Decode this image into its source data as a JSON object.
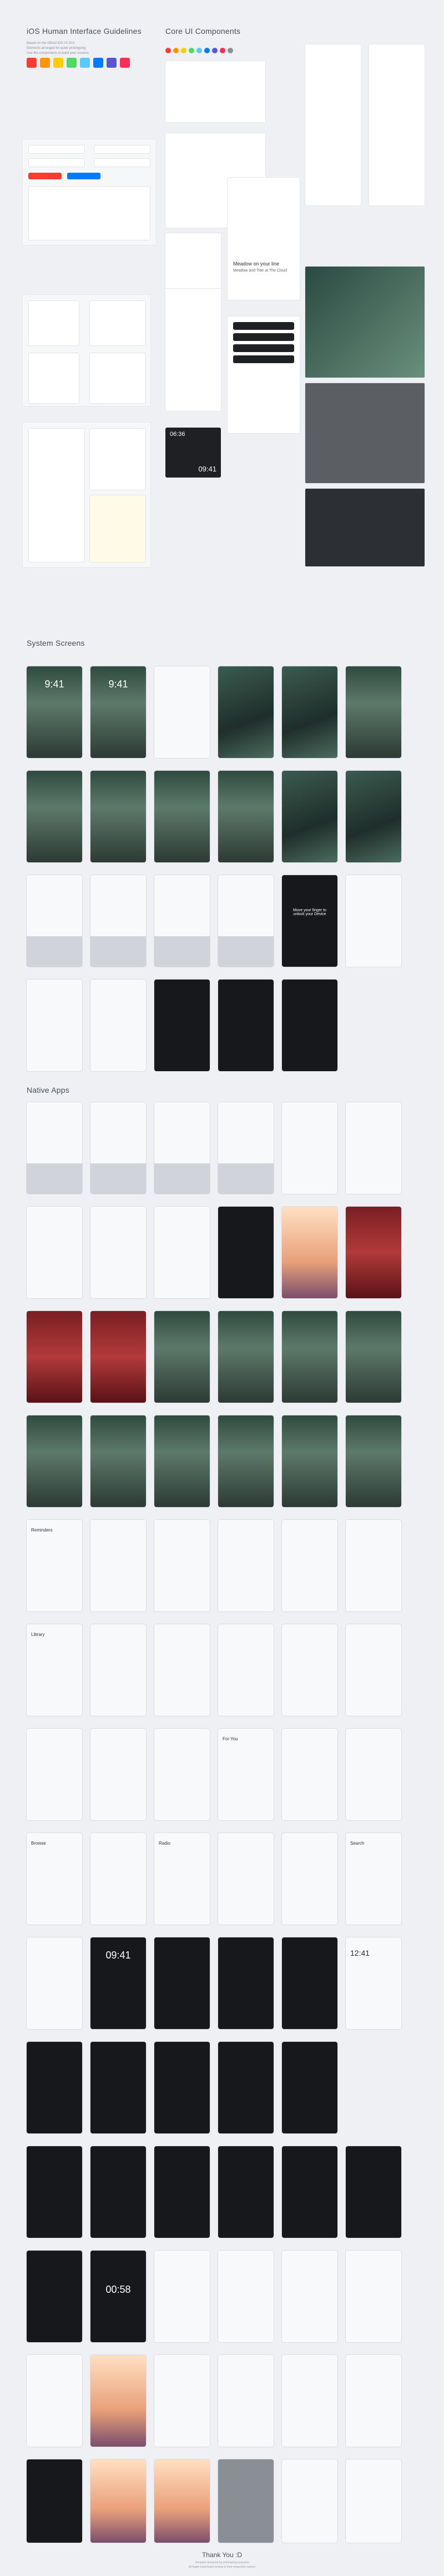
{
  "sections": {
    "guidelines_title": "iOS Human Interface Guidelines",
    "core_title": "Core UI Components",
    "system_title": "System Screens",
    "native_title": "Native Apps"
  },
  "guidelines": {
    "intro_lines": [
      "Based on the official iOS 10 GUI",
      "Elements arranged for quick prototyping",
      "Use the components to build your screens"
    ],
    "palette": [
      "#ff3b30",
      "#ff9500",
      "#ffcc00",
      "#4cd964",
      "#5ac8fa",
      "#007aff",
      "#5856d6",
      "#ff2d55"
    ]
  },
  "core": {
    "app_icon_colors": [
      "#ff3b30",
      "#ff9500",
      "#ffcc00",
      "#4cd964",
      "#5ac8fa",
      "#007aff",
      "#5856d6",
      "#ff2d55",
      "#8e8e93"
    ],
    "time_labels": [
      "06:36",
      "09:41"
    ],
    "sheet_title": "Meadow on your line",
    "sheet_subtitle": "Meadow and Tide at The Cloud"
  },
  "system": {
    "lock_time": "9:41",
    "notice_text": "Move your finger to unlock your Device"
  },
  "native": {
    "page_labels": [
      "Library",
      "Browse",
      "Radio",
      "Search",
      "For You"
    ],
    "clock_times": [
      "09:41",
      "09:41",
      "12:41",
      "00:58"
    ],
    "reminder_title": "Reminders"
  },
  "footer": {
    "thanks": "Thank You :D",
    "credit_1": "Template designed for prototyping purposes",
    "credit_2": "All Apple trademarks belong to their respective owners"
  }
}
